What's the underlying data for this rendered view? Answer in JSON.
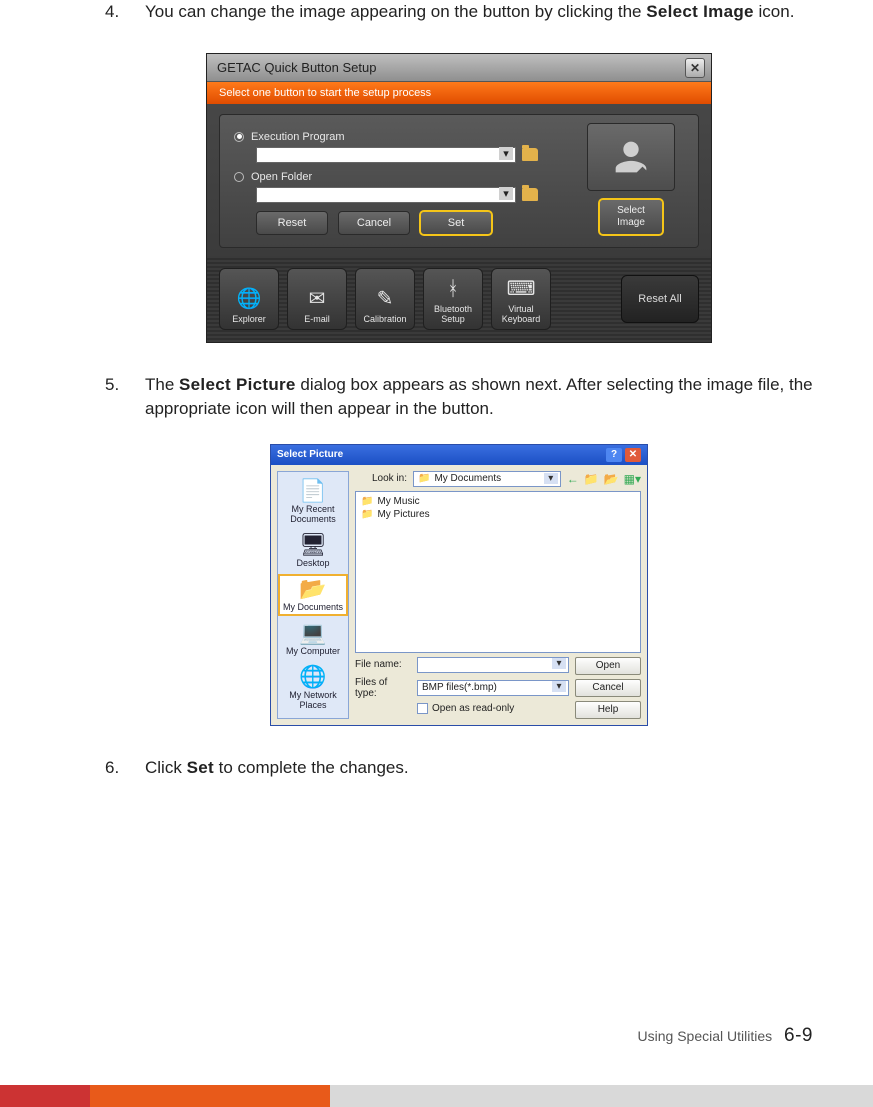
{
  "steps": {
    "s4": {
      "num": "4.",
      "before": "You can change the image appearing on the button by clicking the ",
      "term": "Select Image",
      "after": " icon."
    },
    "s5": {
      "num": "5.",
      "before": "The ",
      "term": "Select Picture",
      "after": " dialog box appears as shown next. After selecting the image file, the appropriate icon will then appear in the button."
    },
    "s6": {
      "num": "6.",
      "before": "Click ",
      "term": "Set",
      "after": " to complete the changes."
    }
  },
  "getac": {
    "title": "GETAC Quick Button Setup",
    "banner": "Select one button to start the setup process",
    "radio_exec": "Execution Program",
    "radio_folder": "Open Folder",
    "btn_reset": "Reset",
    "btn_cancel": "Cancel",
    "btn_set": "Set",
    "select_image": "Select\nImage",
    "tiles": {
      "explorer": "Explorer",
      "email": "E-mail",
      "calibration": "Calibration",
      "bluetooth": "Bluetooth\nSetup",
      "vkbd": "Virtual\nKeyboard"
    },
    "reset_all": "Reset All"
  },
  "selpic": {
    "title": "Select Picture",
    "lookin_label": "Look in:",
    "lookin_value": "My Documents",
    "list": {
      "music": "My Music",
      "pictures": "My Pictures"
    },
    "places": {
      "recent": "My Recent Documents",
      "desktop": "Desktop",
      "mydocs": "My Documents",
      "mycomp": "My Computer",
      "mynet": "My Network Places"
    },
    "filename_label": "File name:",
    "filetype_label": "Files of type:",
    "filetype_value": "BMP files(*.bmp)",
    "readonly": "Open as read-only",
    "btn_open": "Open",
    "btn_cancel": "Cancel",
    "btn_help": "Help"
  },
  "footer": {
    "section": "Using Special Utilities",
    "page": "6-9"
  }
}
